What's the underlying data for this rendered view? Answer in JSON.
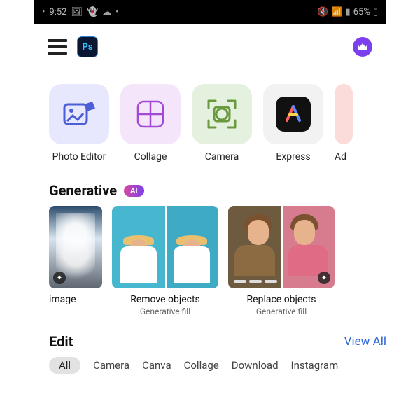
{
  "statusbar": {
    "time": "9:52",
    "battery_pct": "65%",
    "icons_left": [
      "image-icon",
      "snapchat-icon",
      "cloud-icon",
      "dot-icon"
    ],
    "icons_right": [
      "mute-icon",
      "wifi-icon",
      "signal-icon",
      "battery-icon"
    ]
  },
  "header": {
    "app_badge": "Ps"
  },
  "tiles": [
    {
      "label": "Photo Editor",
      "icon": "photo-editor-icon"
    },
    {
      "label": "Collage",
      "icon": "collage-icon"
    },
    {
      "label": "Camera",
      "icon": "camera-icon"
    },
    {
      "label": "Express",
      "icon": "express-icon"
    },
    {
      "label": "Ad",
      "icon": "ad-icon"
    }
  ],
  "generative": {
    "title": "Generative",
    "badge": "AI",
    "items": [
      {
        "title": "image",
        "subtitle": ""
      },
      {
        "title": "Remove objects",
        "subtitle": "Generative fill"
      },
      {
        "title": "Replace objects",
        "subtitle": "Generative fill"
      }
    ]
  },
  "edit": {
    "title": "Edit",
    "view_all": "View All",
    "filters": [
      "All",
      "Camera",
      "Canva",
      "Collage",
      "Download",
      "Instagram"
    ]
  }
}
